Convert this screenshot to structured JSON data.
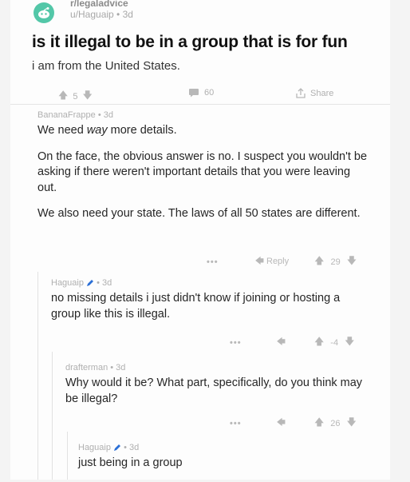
{
  "post": {
    "subreddit": "r/legaladvice",
    "author": "u/Haguaip",
    "age": "3d",
    "title": "is it illegal to be in a group that is for fun",
    "body": "i am from the United States.",
    "score": "5",
    "comments": "60",
    "share_label": "Share"
  },
  "comments": [
    {
      "author": "BananaFrappe",
      "age": "3d",
      "paragraphs": [
        "We need way more details.",
        "On the face, the obvious answer is no. I suspect you wouldn't be asking if there weren't important details that you were leaving out.",
        "We also need your state. The laws of all 50 states are different."
      ],
      "dots": "•••",
      "reply_label": "Reply",
      "score": "29"
    },
    {
      "author": "Haguaip",
      "age": "3d",
      "paragraphs": [
        "no missing details i just didn't know if joining or hosting a group like this is illegal."
      ],
      "dots": "•••",
      "score": "-4"
    },
    {
      "author": "drafterman",
      "age": "3d",
      "paragraphs": [
        "Why would it be? What part, specifically, do you think may be illegal?"
      ],
      "dots": "•••",
      "score": "26"
    },
    {
      "author": "Haguaip",
      "age": "3d",
      "paragraphs": [
        "just being in a group"
      ]
    }
  ],
  "colors": {
    "avatar": "#53c7a8",
    "muted": "#a0a0a0",
    "op_icon": "#2b6fd6"
  },
  "icons": [
    "reddit-avatar-icon",
    "upvote-icon",
    "downvote-icon",
    "comment-icon",
    "share-icon",
    "reply-icon",
    "pencil-icon"
  ]
}
